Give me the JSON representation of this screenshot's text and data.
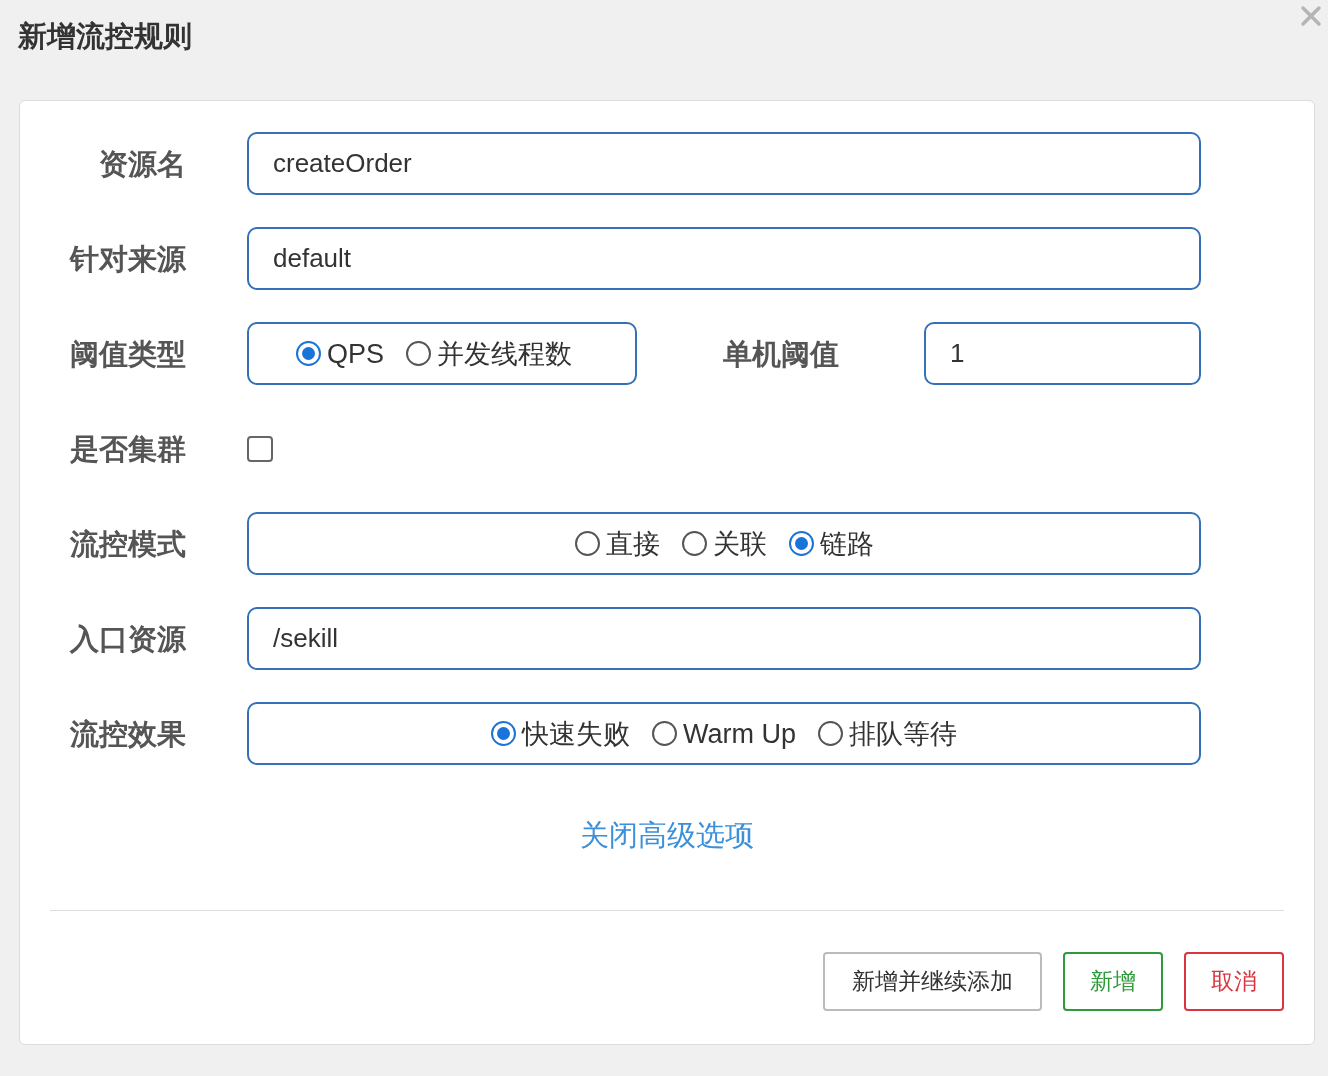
{
  "dialog": {
    "title": "新增流控规则"
  },
  "rows": [
    {
      "kind": "text",
      "label": "资源名",
      "value": "createOrder"
    },
    {
      "kind": "text",
      "label": "针对来源",
      "value": "default"
    },
    {
      "kind": "radio_threshold",
      "label": "阈值类型",
      "options": [
        {
          "label": "QPS",
          "selected": true
        },
        {
          "label": "并发线程数",
          "selected": false
        }
      ],
      "threshold_label": "单机阈值",
      "threshold_value": "1"
    },
    {
      "kind": "checkbox",
      "label": "是否集群",
      "checked": false
    },
    {
      "kind": "radio",
      "label": "流控模式",
      "options": [
        {
          "label": "直接",
          "selected": false
        },
        {
          "label": "关联",
          "selected": false
        },
        {
          "label": "链路",
          "selected": true
        }
      ]
    },
    {
      "kind": "text",
      "label": "入口资源",
      "value": "/sekill"
    },
    {
      "kind": "radio",
      "label": "流控效果",
      "options": [
        {
          "label": "快速失败",
          "selected": true
        },
        {
          "label": "Warm Up",
          "selected": false
        },
        {
          "label": "排队等待",
          "selected": false
        }
      ]
    }
  ],
  "advanced_link": "关闭高级选项",
  "buttons": [
    {
      "label": "新增并继续添加",
      "kind": "default"
    },
    {
      "label": "新增",
      "kind": "success"
    },
    {
      "label": "取消",
      "kind": "danger"
    }
  ]
}
